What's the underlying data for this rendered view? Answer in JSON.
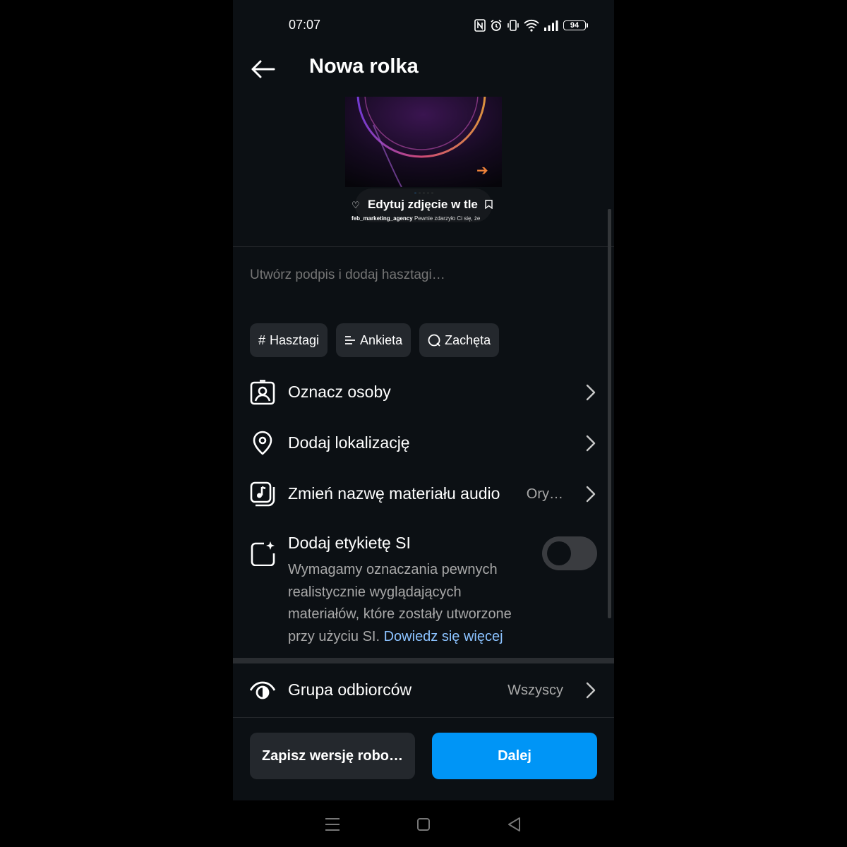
{
  "status_bar": {
    "time": "07:07",
    "battery": "94",
    "icons": [
      "nfc-icon",
      "alarm-icon",
      "vibrate-icon",
      "wifi-icon",
      "signal-icon",
      "battery-icon"
    ]
  },
  "header": {
    "title": "Nowa rolka",
    "back_icon": "arrow-left-icon"
  },
  "preview": {
    "edit_label": "Edytuj zdjęcie w tle",
    "account": "feb_marketing_agency",
    "caption_text": "Pewnie zdarzyło Ci się, że",
    "arrow": "➔"
  },
  "caption": {
    "placeholder": "Utwórz podpis i dodaj hasztagi…"
  },
  "chips": [
    {
      "label": "Hasztagi",
      "icon": "hash-icon"
    },
    {
      "label": "Ankieta",
      "icon": "poll-icon"
    },
    {
      "label": "Zachęta",
      "icon": "prompt-icon"
    }
  ],
  "rows": [
    {
      "label": "Oznacz osoby",
      "icon": "tag-people-icon",
      "value": ""
    },
    {
      "label": "Dodaj lokalizację",
      "icon": "location-pin-icon",
      "value": ""
    },
    {
      "label": "Zmień nazwę materiału audio",
      "icon": "audio-icon",
      "value": "Ory…"
    }
  ],
  "ai_label": {
    "title": "Dodaj etykietę SI",
    "description": "Wymagamy oznaczania pewnych realistycznie wyglądających materiałów, które zostały utworzone przy użyciu SI.",
    "link": "Dowiedz się więcej",
    "toggle_on": false
  },
  "audience": {
    "label": "Grupa odbiorców",
    "value": "Wszyscy"
  },
  "buttons": {
    "draft": "Zapisz wersję robo…",
    "next": "Dalej"
  },
  "colors": {
    "background": "#0c1014",
    "accent": "#0095f6",
    "link": "#8bc2ff",
    "secondary_text": "#a8a8a8",
    "chip_bg": "#24282d"
  }
}
